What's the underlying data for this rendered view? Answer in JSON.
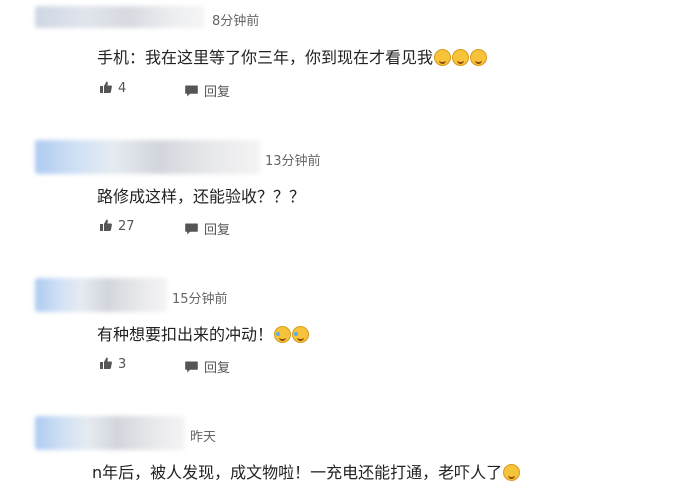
{
  "comments": [
    {
      "time": "8分钟前",
      "text": "手机：我在这里等了你三年，你到现在才看见我",
      "likes": "4",
      "reply": "回复"
    },
    {
      "time": "13分钟前",
      "text": "路修成这样，还能验收？？？",
      "likes": "27",
      "reply": "回复"
    },
    {
      "time": "15分钟前",
      "text": "有种想要扣出来的冲动！",
      "likes": "3",
      "reply": "回复"
    },
    {
      "time": "昨天",
      "text": "n年后，被人发现，成文物啦！一充电还能打通，老吓人了"
    }
  ],
  "icons": {
    "like": "thumbs-up-icon",
    "reply": "speech-bubble-icon",
    "emoji": "emoji-icon"
  },
  "colors": {
    "text": "#222222",
    "meta": "#666666",
    "emoji": "#f7c33a"
  }
}
